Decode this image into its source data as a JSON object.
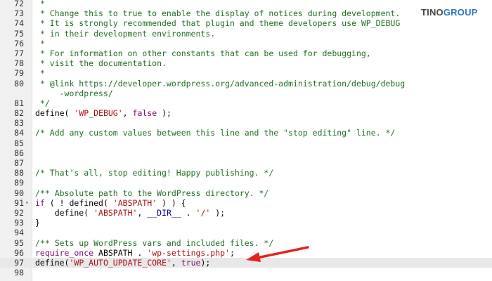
{
  "logo": {
    "text_a": "TINO",
    "text_b": "GROUP"
  },
  "colors": {
    "arrow": "#e5231d",
    "comment": "#236e24",
    "keyword": "#7a0874",
    "string": "#a11",
    "constant": "#0000a0"
  },
  "lines": [
    {
      "n": "72",
      "tokens": [
        {
          "t": " *",
          "c": "t-c"
        }
      ]
    },
    {
      "n": "73",
      "tokens": [
        {
          "t": " * Change this to true to enable the display of notices during development.",
          "c": "t-c"
        }
      ]
    },
    {
      "n": "74",
      "tokens": [
        {
          "t": " * It is strongly recommended that plugin and theme developers use WP_DEBUG",
          "c": "t-c"
        }
      ]
    },
    {
      "n": "75",
      "tokens": [
        {
          "t": " * in their development environments.",
          "c": "t-c"
        }
      ]
    },
    {
      "n": "76",
      "tokens": [
        {
          "t": " *",
          "c": "t-c"
        }
      ]
    },
    {
      "n": "77",
      "tokens": [
        {
          "t": " * For information on other constants that can be used for debugging,",
          "c": "t-c"
        }
      ]
    },
    {
      "n": "78",
      "tokens": [
        {
          "t": " * visit the documentation.",
          "c": "t-c"
        }
      ]
    },
    {
      "n": "79",
      "tokens": [
        {
          "t": " *",
          "c": "t-c"
        }
      ]
    },
    {
      "n": "80",
      "tokens": [
        {
          "t": " * @link https://developer.wordpress.org/advanced-administration/debug/debug",
          "c": "t-c"
        }
      ]
    },
    {
      "n": "",
      "tokens": [
        {
          "t": "     -wordpress/",
          "c": "t-c"
        }
      ]
    },
    {
      "n": "81",
      "tokens": [
        {
          "t": " */",
          "c": "t-c"
        }
      ]
    },
    {
      "n": "82",
      "tokens": [
        {
          "t": "define",
          "c": "t-f"
        },
        {
          "t": "( ",
          "c": "t-p"
        },
        {
          "t": "'WP_DEBUG'",
          "c": "t-s"
        },
        {
          "t": ", ",
          "c": "t-p"
        },
        {
          "t": "false",
          "c": "t-k"
        },
        {
          "t": " );",
          "c": "t-p"
        }
      ]
    },
    {
      "n": "83",
      "tokens": []
    },
    {
      "n": "84",
      "tokens": [
        {
          "t": "/* Add any custom values between this line and the \"stop editing\" line. */",
          "c": "t-c"
        }
      ]
    },
    {
      "n": "85",
      "tokens": []
    },
    {
      "n": "86",
      "tokens": []
    },
    {
      "n": "87",
      "tokens": []
    },
    {
      "n": "88",
      "tokens": [
        {
          "t": "/* That's all, stop editing! Happy publishing. */",
          "c": "t-c"
        }
      ]
    },
    {
      "n": "89",
      "tokens": []
    },
    {
      "n": "90",
      "tokens": [
        {
          "t": "/** Absolute path to the WordPress directory. */",
          "c": "t-c"
        }
      ]
    },
    {
      "n": "91",
      "fold": "▾",
      "tokens": [
        {
          "t": "if",
          "c": "t-k"
        },
        {
          "t": " ( ! ",
          "c": "t-p"
        },
        {
          "t": "defined",
          "c": "t-f"
        },
        {
          "t": "( ",
          "c": "t-p"
        },
        {
          "t": "'ABSPATH'",
          "c": "t-s"
        },
        {
          "t": " ) ) {",
          "c": "t-p"
        }
      ]
    },
    {
      "n": "92",
      "tokens": [
        {
          "t": "    define",
          "c": "t-f"
        },
        {
          "t": "( ",
          "c": "t-p"
        },
        {
          "t": "'ABSPATH'",
          "c": "t-s"
        },
        {
          "t": ", ",
          "c": "t-p"
        },
        {
          "t": "__DIR__",
          "c": "t-cn"
        },
        {
          "t": " . ",
          "c": "t-p"
        },
        {
          "t": "'/'",
          "c": "t-s"
        },
        {
          "t": " );",
          "c": "t-p"
        }
      ]
    },
    {
      "n": "93",
      "tokens": [
        {
          "t": "}",
          "c": "t-p"
        }
      ]
    },
    {
      "n": "94",
      "tokens": []
    },
    {
      "n": "95",
      "tokens": [
        {
          "t": "/** Sets up WordPress vars and included files. */",
          "c": "t-c"
        }
      ]
    },
    {
      "n": "96",
      "tokens": [
        {
          "t": "require_once",
          "c": "t-k"
        },
        {
          "t": " ABSPATH . ",
          "c": "t-p"
        },
        {
          "t": "'wp-settings.php'",
          "c": "t-s"
        },
        {
          "t": ";",
          "c": "t-p"
        }
      ]
    },
    {
      "n": "97",
      "active": true,
      "tokens": [
        {
          "t": "define",
          "c": "t-f"
        },
        {
          "t": "(",
          "c": "t-p"
        },
        {
          "t": "'WP_AUTO_UPDATE_CORE'",
          "c": "t-s"
        },
        {
          "t": ", ",
          "c": "t-p"
        },
        {
          "t": "true",
          "c": "t-k"
        },
        {
          "t": ");",
          "c": "t-p"
        }
      ]
    },
    {
      "n": "98",
      "tokens": []
    }
  ]
}
